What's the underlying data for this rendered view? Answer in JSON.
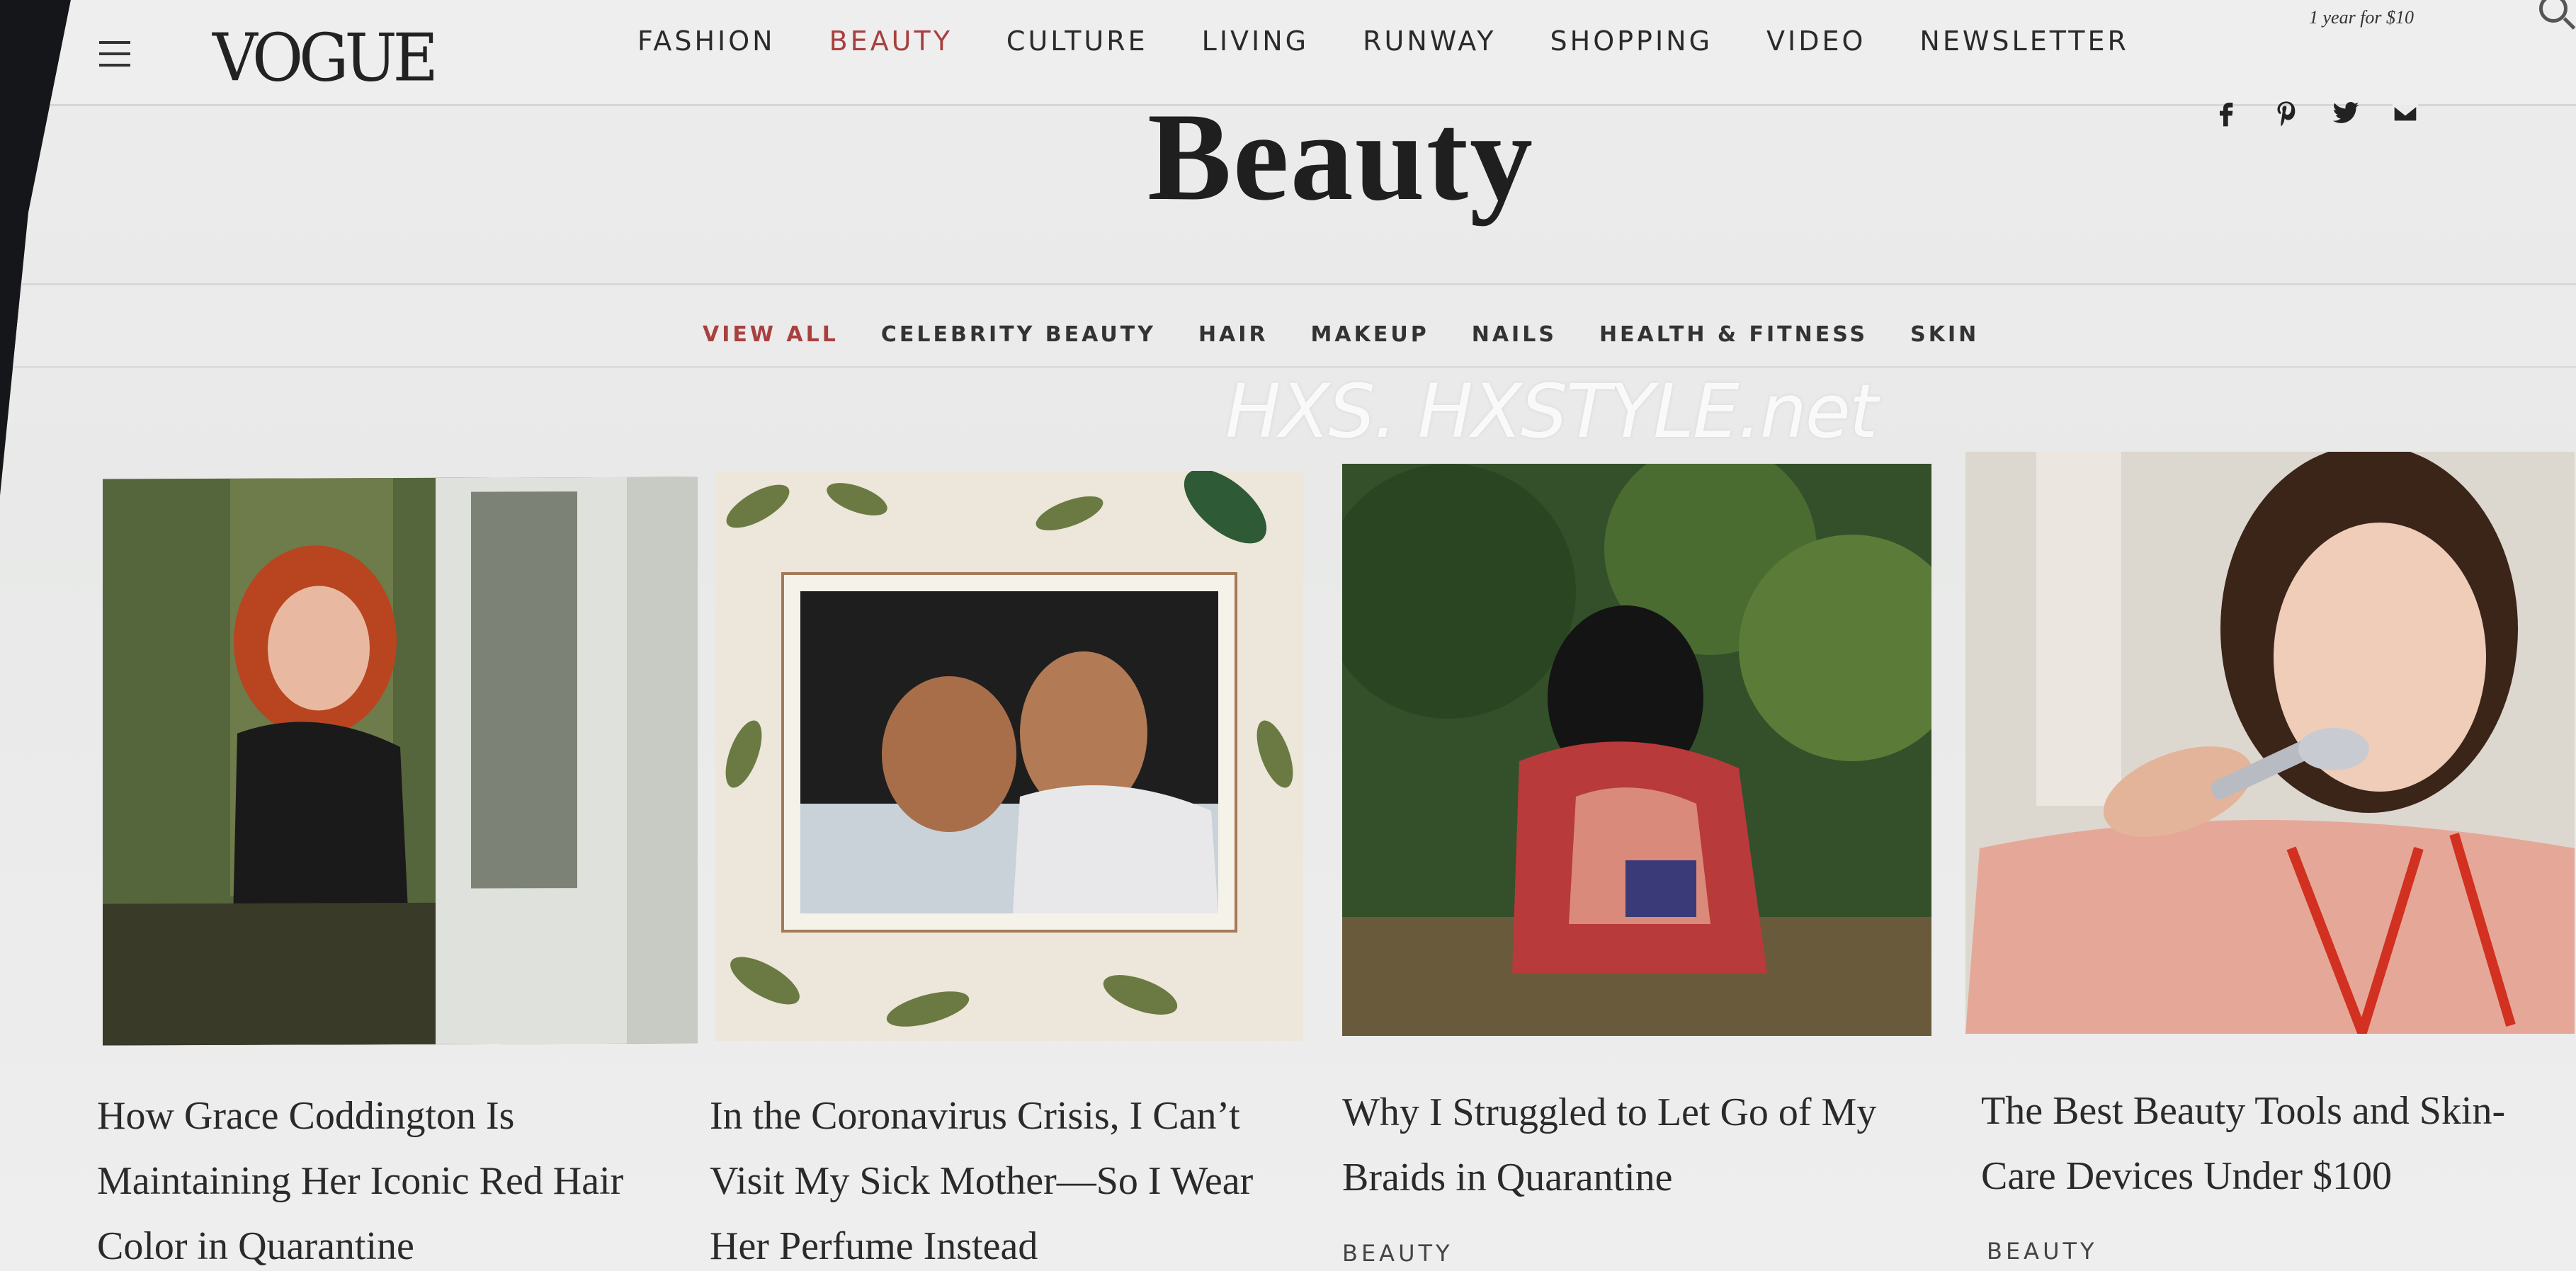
{
  "nav": {
    "logo": "VOGUE",
    "items": [
      {
        "label": "FASHION",
        "active": false
      },
      {
        "label": "BEAUTY",
        "active": true
      },
      {
        "label": "CULTURE",
        "active": false
      },
      {
        "label": "LIVING",
        "active": false
      },
      {
        "label": "RUNWAY",
        "active": false
      },
      {
        "label": "SHOPPING",
        "active": false
      },
      {
        "label": "VIDEO",
        "active": false
      },
      {
        "label": "NEWSLETTER",
        "active": false
      }
    ],
    "promo": "1 year for $10"
  },
  "header": {
    "title": "Beauty",
    "social": [
      "facebook-icon",
      "pinterest-icon",
      "twitter-icon",
      "email-icon"
    ]
  },
  "subnav": {
    "items": [
      {
        "label": "VIEW ALL",
        "active": true
      },
      {
        "label": "CELEBRITY BEAUTY",
        "active": false
      },
      {
        "label": "HAIR",
        "active": false
      },
      {
        "label": "MAKEUP",
        "active": false
      },
      {
        "label": "NAILS",
        "active": false
      },
      {
        "label": "HEALTH & FITNESS",
        "active": false
      },
      {
        "label": "SKIN",
        "active": false
      }
    ]
  },
  "watermark": "HXS. HXSTYLE.net",
  "articles": [
    {
      "headline_lines": [
        "How Grace Coddington Is",
        "Maintaining Her Iconic Red Hair",
        "Color in Quarantine"
      ],
      "rubric": ""
    },
    {
      "headline_lines": [
        "In the Coronavirus Crisis, I Can’t",
        "Visit My Sick Mother—So I Wear",
        "Her Perfume Instead"
      ],
      "rubric": ""
    },
    {
      "headline_lines": [
        "Why I Struggled to Let Go of My",
        "Braids in Quarantine"
      ],
      "rubric": "BEAUTY"
    },
    {
      "headline_lines": [
        "The Best Beauty Tools and Skin-",
        "Care Devices Under $100"
      ],
      "rubric": "BEAUTY"
    }
  ],
  "colors": {
    "accent": "#a84040",
    "text": "#2a2a2a",
    "background": "#ececec"
  }
}
